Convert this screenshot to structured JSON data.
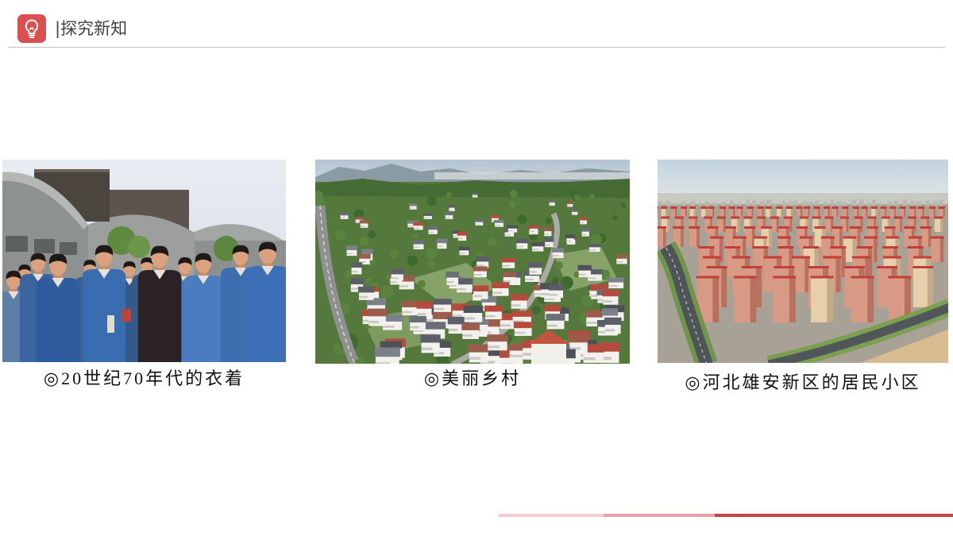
{
  "header": {
    "title": "|探究新知",
    "icon": "lightbulb-icon"
  },
  "photos": [
    {
      "caption": "◎20世纪70年代的衣着"
    },
    {
      "caption": "◎美丽乡村"
    },
    {
      "caption": "◎河北雄安新区的居民小区"
    }
  ],
  "colors": {
    "accent": "#d8504f",
    "divider": "#c4c4c4",
    "footer_bar": [
      "#f4cdd0",
      "#e7a0a6",
      "#c8414b"
    ]
  }
}
